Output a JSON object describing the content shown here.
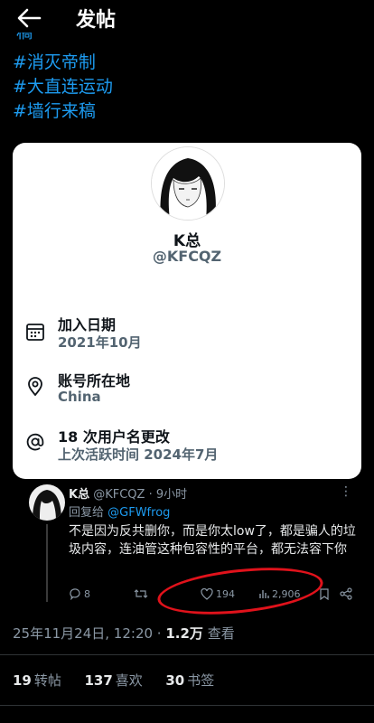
{
  "header": {
    "title": "发帖"
  },
  "hashtags": [
    "#消灭帝制",
    "#大直连运动",
    "#墙行来稿"
  ],
  "cut_text": "稿",
  "profile_card": {
    "name": "K总",
    "handle": "@KFCQZ",
    "joined_title": "加入日期",
    "joined_value": "2021年10月",
    "location_title": "账号所在地",
    "location_value": "China",
    "username_changes_title": "18 次用户名更改",
    "last_active": "上次活跃时间 2024年7月"
  },
  "quoted_tweet": {
    "name": "K总",
    "handle": "@KFCQZ",
    "time": "· 9小时",
    "reply_label": "回复给",
    "reply_handle": "@GFWfrog",
    "text": "不是因为反共删你，而是你太low了，都是骗人的垃圾内容，连油管这种包容性的平台，都无法容下你",
    "replies": "8",
    "retweets": "",
    "likes": "194",
    "views": "2,906"
  },
  "post_meta": {
    "timestamp": "25年11月24日, 12:20 ·",
    "views_count": "1.2万",
    "views_label": "查看"
  },
  "stats": {
    "reposts_count": "19",
    "reposts_label": "转帖",
    "likes_count": "137",
    "likes_label": "喜欢",
    "bookmarks_count": "30",
    "bookmarks_label": "书签"
  },
  "colors": {
    "accent": "#1d9bf0",
    "highlight": "#e0121b"
  }
}
